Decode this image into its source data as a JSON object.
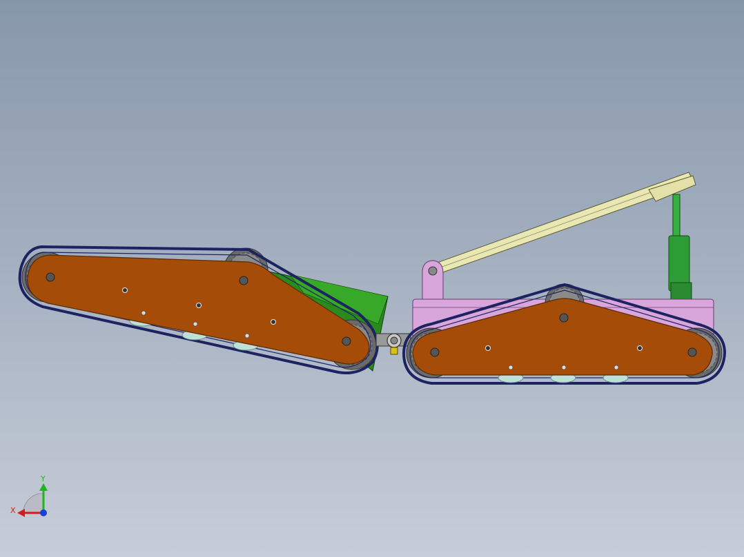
{
  "colors": {
    "background_top": "#8797aa",
    "background_bottom": "#c7cdd8",
    "track": "#1c2360",
    "side_plate": "#a44c08",
    "sprocket": "#6f6f6f",
    "wedge": "#2a8a1c",
    "chassis": "#d9a6dc",
    "arm": "#e9e7b4",
    "cylinder": "#2c9c34",
    "roller": "#bfe0d8"
  },
  "triad": {
    "y_label": "Y",
    "x_label": "X",
    "y_axis_color": "#1fb51f",
    "x_axis_color": "#d41c1c",
    "z_axis_color": "#1c3fd4"
  }
}
